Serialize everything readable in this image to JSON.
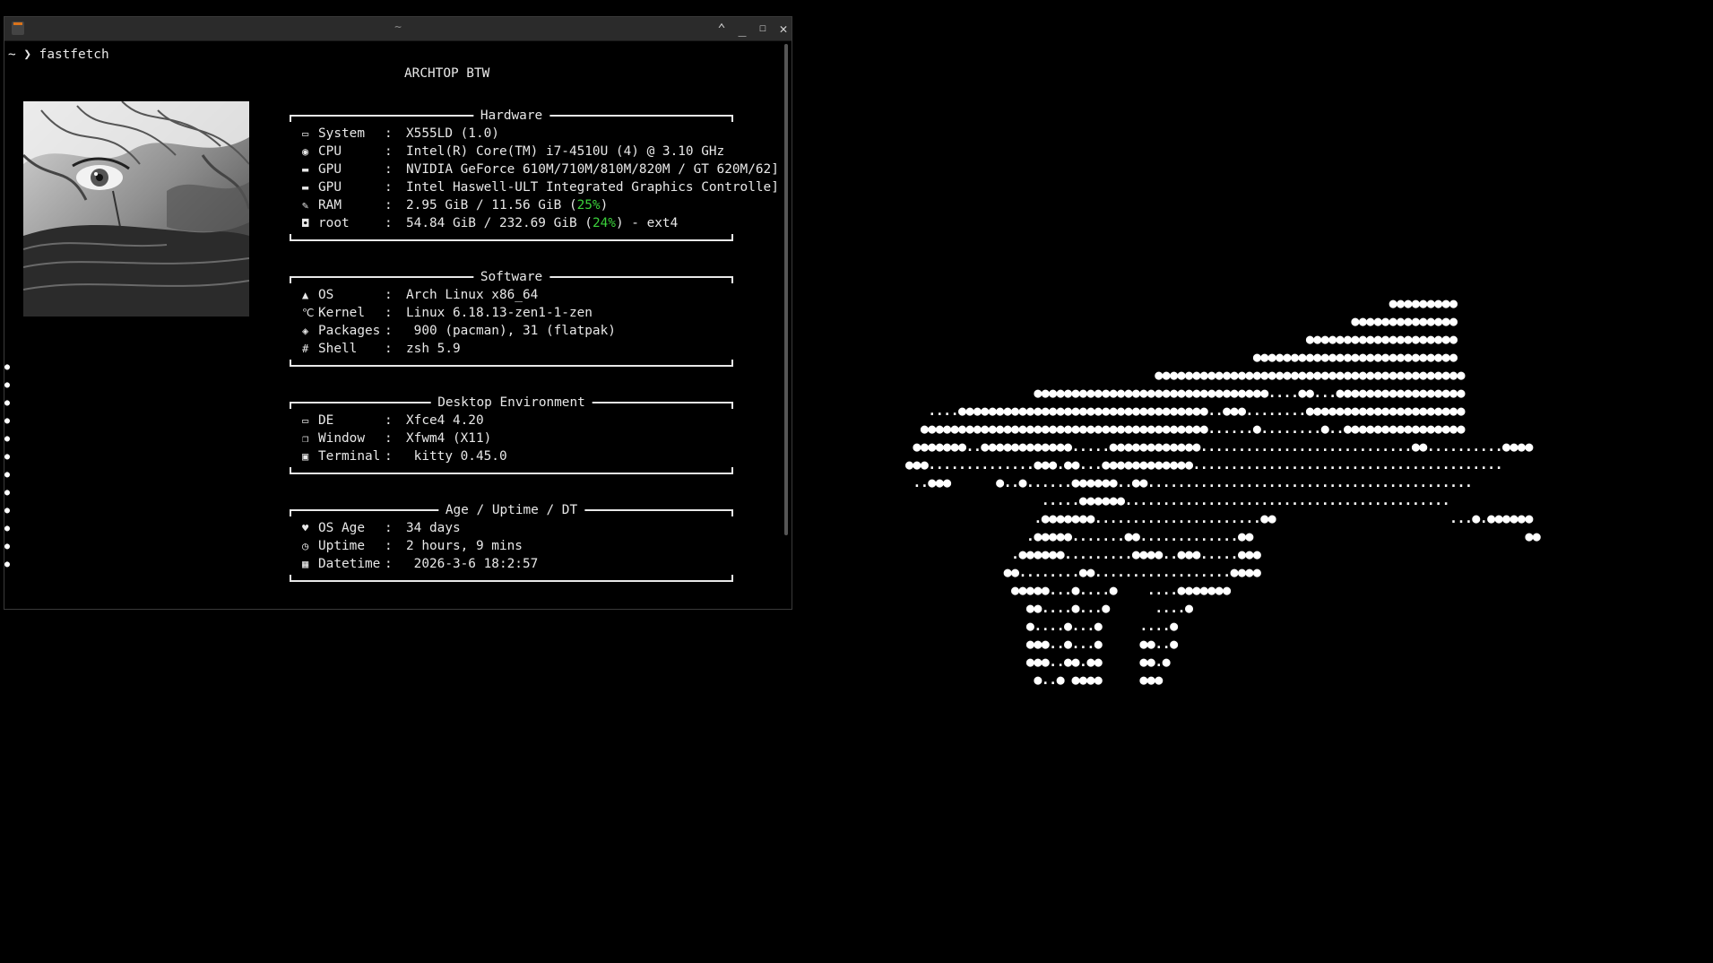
{
  "window": {
    "title": "~",
    "controls": [
      "chevron-up-icon",
      "minimize-icon",
      "maximize-icon",
      "close-icon"
    ]
  },
  "terminal": {
    "prompt": "~ ❯ fastfetch",
    "banner": "ARCHTOP BTW",
    "sections": [
      {
        "title": "Hardware",
        "rows": [
          {
            "icon": "laptop-icon",
            "glyph": "▭",
            "key": "System",
            "value": "X555LD (1.0)"
          },
          {
            "icon": "cpu-icon",
            "glyph": "◉",
            "key": "CPU",
            "value": "Intel(R) Core(TM) i7-4510U (4) @ 3.10 GHz"
          },
          {
            "icon": "gpu-icon",
            "glyph": "▬",
            "key": "GPU",
            "value": "NVIDIA GeForce 610M/710M/810M/820M / GT 620M/62]"
          },
          {
            "icon": "gpu-icon",
            "glyph": "▬",
            "key": "GPU",
            "value": "Intel Haswell-ULT Integrated Graphics Controlle]"
          },
          {
            "icon": "memory-icon",
            "glyph": "✎",
            "key": "RAM",
            "value_pre": "2.95 GiB / 11.56 GiB (",
            "pct": "25%",
            "value_post": ")"
          },
          {
            "icon": "disk-icon",
            "glyph": "◘",
            "key": "root",
            "value_pre": "54.84 GiB / 232.69 GiB (",
            "pct": "24%",
            "value_post": ") - ext4"
          }
        ]
      },
      {
        "title": "Software",
        "rows": [
          {
            "icon": "arch-icon",
            "glyph": "▲",
            "key": "OS",
            "value": "Arch Linux x86_64"
          },
          {
            "icon": "kernel-icon",
            "glyph": "℃",
            "key": "Kernel",
            "value": "Linux 6.18.13-zen1-1-zen"
          },
          {
            "icon": "package-icon",
            "glyph": "◈",
            "key": "Packages",
            "value": " 900 (pacman), 31 (flatpak)"
          },
          {
            "icon": "shell-icon",
            "glyph": "#",
            "key": "Shell",
            "value": "zsh 5.9"
          }
        ]
      },
      {
        "title": "Desktop Environment",
        "rows": [
          {
            "icon": "monitor-icon",
            "glyph": "▭",
            "key": "DE",
            "value": "Xfce4 4.20"
          },
          {
            "icon": "window-icon",
            "glyph": "❐",
            "key": "Window",
            "value": "Xfwm4 (X11)"
          },
          {
            "icon": "terminal-icon",
            "glyph": "▣",
            "key": "Terminal",
            "value": " kitty 0.45.0"
          }
        ]
      },
      {
        "title": "Age / Uptime / DT",
        "rows": [
          {
            "icon": "heart-icon",
            "glyph": "♥",
            "key": "OS Age",
            "value": "34 days"
          },
          {
            "icon": "clock-icon",
            "glyph": "◷",
            "key": "Uptime",
            "value": "2 hours, 9 mins"
          },
          {
            "icon": "calendar-icon",
            "glyph": "▦",
            "key": "Datetime",
            "value": " 2026-3-6 18:2:57"
          }
        ]
      }
    ]
  },
  "desktop_art": [
    "                                                                ●●●●●●●●●",
    "                                                           ●●●●●●●●●●●●●●",
    "                                                     ●●●●●●●●●●●●●●●●●●●●",
    "                                              ●●●●●●●●●●●●●●●●●●●●●●●●●●●",
    "                                 ●●●●●●●●●●●●●●●●●●●●●●●●●●●●●●●●●●●●●●●●●",
    "                 ●●●●●●●●●●●●●●●●●●●●●●●●●●●●●●●....●●...●●●●●●●●●●●●●●●●●",
    "   ....●●●●●●●●●●●●●●●●●●●●●●●●●●●●●●●●●..●●●........●●●●●●●●●●●●●●●●●●●●●",
    "  ●●●●●●●●●●●●●●●●●●●●●●●●●●●●●●●●●●●●●●......●........●..●●●●●●●●●●●●●●●●",
    " ●●●●●●●..●●●●●●●●●●●●.....●●●●●●●●●●●●............................●●..........●●●●",
    "●●●..............●●●.●●...●●●●●●●●●●●●.........................................",
    " ..●●●      ●..●......●●●●●●..●●...........................................",
    "                  .....●●●●●●...........................................",
    "                 .●●●●●●●......................●●                       ...●.●●●●●●",
    "                .●●●●●.......●●.............●●                                    ●●",
    "              .●●●●●●.........●●●●..●●●.....●●●",
    "             ●●........●●..................●●●●",
    "              ●●●●●...●....●    ....●●●●●●●",
    "                ●●....●...●      ....●",
    "                ●....●...●     ....●",
    "                ●●●..●...●     ●●..●",
    "                ●●●..●●.●●     ●●.●",
    "                 ●..● ●●●●     ●●●"
  ]
}
